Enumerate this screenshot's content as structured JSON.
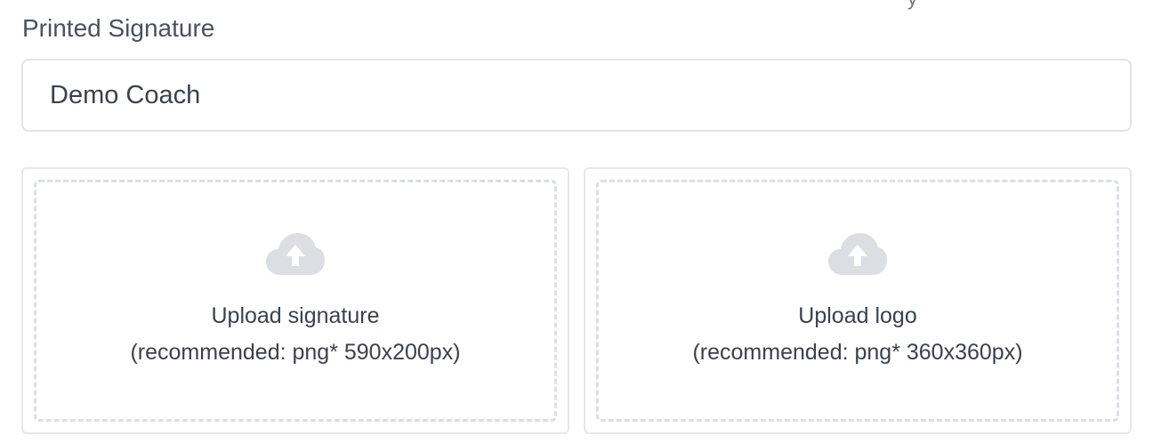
{
  "header": {
    "cut_off_text": "y"
  },
  "printed_signature": {
    "label": "Printed Signature",
    "value": "Demo Coach"
  },
  "uploads": [
    {
      "title": "Upload signature",
      "hint": "(recommended: png* 590x200px)",
      "icon": "cloud-upload-icon"
    },
    {
      "title": "Upload logo",
      "hint": "(recommended: png* 360x360px)",
      "icon": "cloud-upload-icon"
    }
  ],
  "colors": {
    "text": "#3a4150",
    "border": "#e2e4e8",
    "dashed_border": "#dcdfe4",
    "icon": "#dcdee3"
  }
}
